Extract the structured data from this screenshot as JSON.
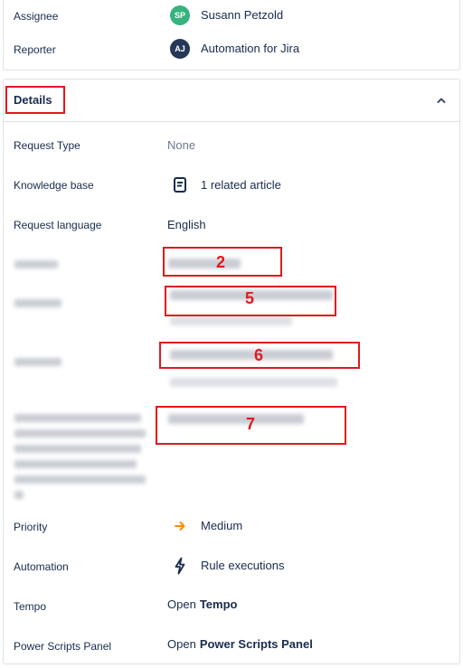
{
  "people": {
    "assignee_label": "Assignee",
    "assignee_initials": "SP",
    "assignee_name": "Susann Petzold",
    "reporter_label": "Reporter",
    "reporter_initials": "AJ",
    "reporter_name": "Automation for Jira"
  },
  "details": {
    "title": "Details",
    "request_type_label": "Request Type",
    "request_type_value": "None",
    "knowledge_base_label": "Knowledge base",
    "knowledge_base_value": "1 related article",
    "request_language_label": "Request language",
    "request_language_value": "English",
    "annotation_2": "2",
    "annotation_5": "5",
    "annotation_6": "6",
    "annotation_7": "7",
    "priority_label": "Priority",
    "priority_value": "Medium",
    "automation_label": "Automation",
    "automation_value": "Rule executions",
    "tempo_label": "Tempo",
    "tempo_open": "Open",
    "tempo_name": "Tempo",
    "power_label": "Power Scripts Panel",
    "power_open": "Open",
    "power_name": "Power Scripts Panel"
  },
  "colors": {
    "assignee_avatar": "#36b37e",
    "reporter_avatar": "#253858",
    "priority_medium": "#ff8b00",
    "annotation_red": "#e0191e"
  },
  "icons": {
    "knowledge_base": "book-icon",
    "priority": "arrow-right-icon",
    "automation": "lightning-icon",
    "collapse": "chevron-up-icon"
  }
}
